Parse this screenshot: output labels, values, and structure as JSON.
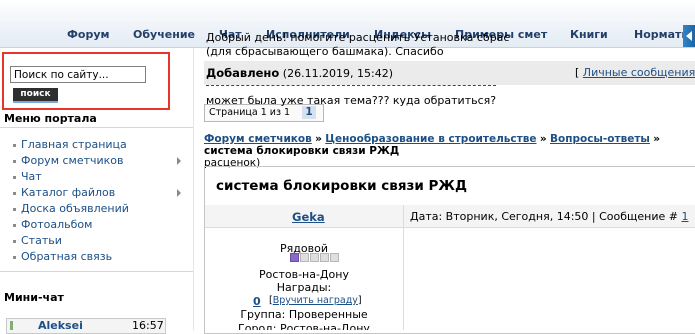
{
  "nav": {
    "items": [
      "Форум",
      "Обучение",
      "Чат",
      "Исполнители",
      "Индексы",
      "Примеры смет",
      "Книги",
      "Нормативы"
    ]
  },
  "search": {
    "placeholder": "Поиск по сайту...",
    "button": "поиск"
  },
  "sidebar": {
    "menu_title": "Меню портала",
    "items": [
      {
        "label": "Главная страница",
        "submenu": false
      },
      {
        "label": "Форум сметчиков",
        "submenu": true
      },
      {
        "label": "Чат",
        "submenu": false
      },
      {
        "label": "Каталог файлов",
        "submenu": true
      },
      {
        "label": "Доска объявлений",
        "submenu": false
      },
      {
        "label": "Фотоальбом",
        "submenu": false
      },
      {
        "label": "Статьи",
        "submenu": false
      },
      {
        "label": "Обратная связь",
        "submenu": false
      }
    ],
    "minichat_title": "Мини-чат",
    "chat": {
      "user": "Aleksei",
      "time": "16:57"
    }
  },
  "pm": {
    "open": "[",
    "link": "Личные сообщения"
  },
  "pager": {
    "label": "Страница 1 из 1",
    "current": "1"
  },
  "breadcrumb": {
    "links": [
      "Форум сметчиков",
      "Ценообразование в строительстве",
      "Вопросы-ответы"
    ],
    "separator": "»",
    "current": "система блокировки связи РЖД",
    "wrap": "расценок)"
  },
  "thread": {
    "title": "система блокировки связи РЖД"
  },
  "post": {
    "author": "Geka",
    "rank": "Рядовой",
    "rank_level": 1,
    "rank_max": 5,
    "city": "Ростов-на-Дону",
    "awards_label": "Награды:",
    "awards_count": "0",
    "award_link": "Вручить награду",
    "group": "Группа: Проверенные",
    "city_line": "Город: Ростов-на-Дону",
    "date": "Дата: Вторник, Сегодня, 14:50",
    "msg_label": "| Сообщение #",
    "msg_num": "1",
    "body_line1": "Добрый день! помогите расценить Установка сбрас",
    "body_line2": "(для сбрасывающего башмака). Спасибо",
    "added_label": "Добавлено",
    "added_date": "(26.11.2019, 15:42)",
    "body_line3": "может была уже такая тема??? куда обратиться?"
  },
  "colors": {
    "accent": "#1c4f86",
    "nav_text": "#22406a",
    "highlight": "#e8352b"
  }
}
